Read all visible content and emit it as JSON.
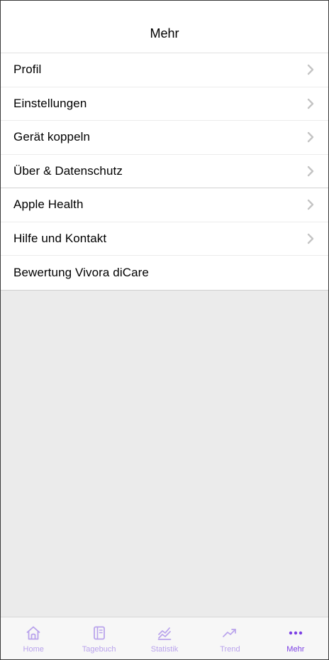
{
  "header": {
    "title": "Mehr"
  },
  "menu": {
    "items": [
      {
        "label": "Profil",
        "chevron": true
      },
      {
        "label": "Einstellungen",
        "chevron": true
      },
      {
        "label": "Gerät koppeln",
        "chevron": true
      },
      {
        "label": "Über & Datenschutz",
        "chevron": true
      },
      {
        "label": "Apple Health",
        "chevron": true
      },
      {
        "label": "Hilfe und Kontakt",
        "chevron": true
      },
      {
        "label": "Bewertung Vivora diCare",
        "chevron": false
      }
    ]
  },
  "tabbar": {
    "tabs": [
      {
        "label": "Home",
        "icon": "home-icon",
        "active": false
      },
      {
        "label": "Tagebuch",
        "icon": "diary-icon",
        "active": false
      },
      {
        "label": "Statistik",
        "icon": "statistics-icon",
        "active": false
      },
      {
        "label": "Trend",
        "icon": "trend-icon",
        "active": false
      },
      {
        "label": "Mehr",
        "icon": "more-icon",
        "active": true
      }
    ]
  },
  "colors": {
    "accent": "#7b3fe4",
    "accent_light": "#b9a3ec",
    "background": "#ebebeb",
    "chevron": "#c4c4c4"
  }
}
